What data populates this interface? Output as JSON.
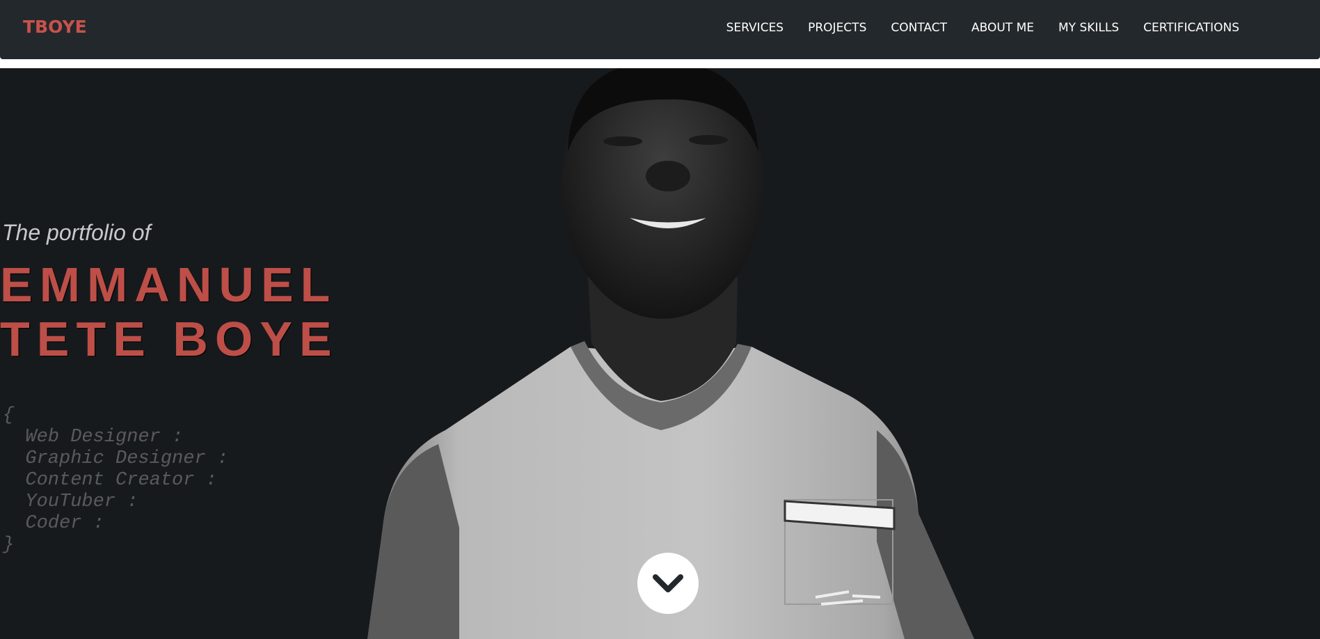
{
  "navbar": {
    "brand": "TBOYE",
    "links": [
      {
        "label": "SERVICES"
      },
      {
        "label": "PROJECTS"
      },
      {
        "label": "CONTACT"
      },
      {
        "label": "ABOUT ME"
      },
      {
        "label": "MY SKILLS"
      },
      {
        "label": "CERTIFICATIONS"
      }
    ]
  },
  "hero": {
    "intro": "The portfolio of",
    "name_line_1": "EMMANUEL",
    "name_line_2": "TETE BOYE",
    "code_open": "{",
    "roles": [
      "  Web Designer :",
      "  Graphic Designer :",
      "  Content Creator :",
      "  YouTuber :",
      "  Coder :"
    ],
    "code_close": "}",
    "scroll_icon": "chevron-down-icon"
  },
  "colors": {
    "accent": "#c8524c",
    "nav_bg": "#23282c",
    "hero_bg": "#171a1d",
    "code_text": "#5a5a5a"
  }
}
